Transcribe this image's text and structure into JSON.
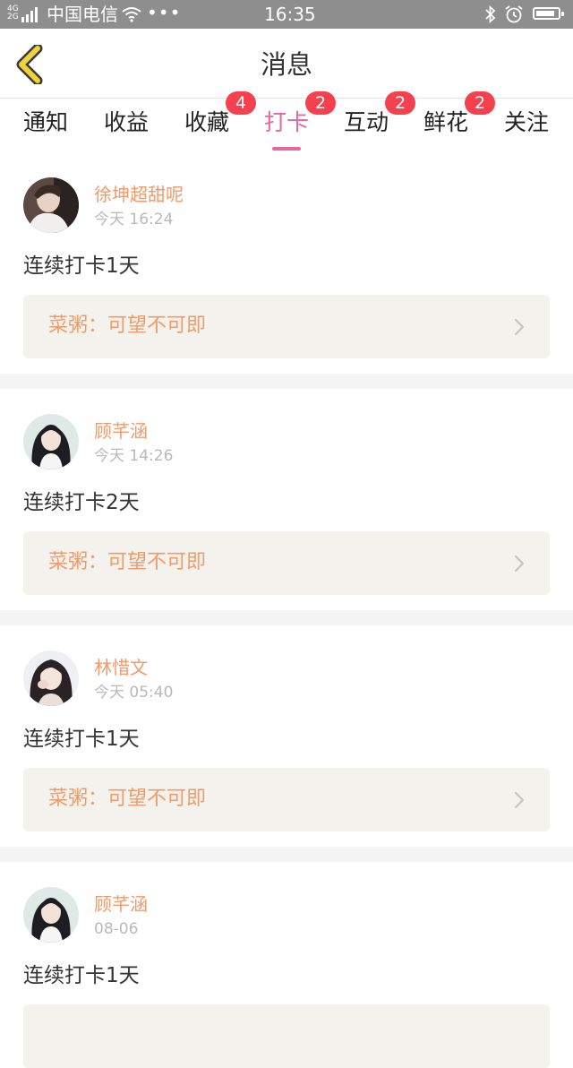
{
  "status_bar": {
    "network_top": "4G",
    "network_bottom": "2G",
    "carrier": "中国电信",
    "dots": "•••",
    "time": "16:35",
    "battery_level": 0.85,
    "icons": [
      "signal-icon",
      "wifi-icon",
      "bluetooth-icon",
      "alarm-icon",
      "battery-icon"
    ]
  },
  "header": {
    "title": "消息",
    "back_icon": "chevron-left-icon",
    "accent_color": "#f0d23a"
  },
  "tabs": [
    {
      "label": "通知",
      "badge": null,
      "active": false
    },
    {
      "label": "收益",
      "badge": null,
      "active": false
    },
    {
      "label": "收藏",
      "badge": "4",
      "active": false
    },
    {
      "label": "打卡",
      "badge": "2",
      "active": true
    },
    {
      "label": "互动",
      "badge": "2",
      "active": false
    },
    {
      "label": "鲜花",
      "badge": "2",
      "active": false
    },
    {
      "label": "关注",
      "badge": null,
      "active": false
    }
  ],
  "colors": {
    "active_tab": "#e5679d",
    "badge": "#f5404f",
    "username": "#f29a6a",
    "link_box_bg": "#f4f2ec"
  },
  "feed": [
    {
      "username": "徐坤超甜呢",
      "time": "今天 16:24",
      "text": "连续打卡1天",
      "link": "菜粥：可望不可即"
    },
    {
      "username": "顾芊涵",
      "time": "今天 14:26",
      "text": "连续打卡2天",
      "link": "菜粥：可望不可即"
    },
    {
      "username": "林惜文",
      "time": "今天 05:40",
      "text": "连续打卡1天",
      "link": "菜粥：可望不可即"
    },
    {
      "username": "顾芊涵",
      "time": "08-06",
      "text": "连续打卡1天",
      "link": ""
    }
  ]
}
